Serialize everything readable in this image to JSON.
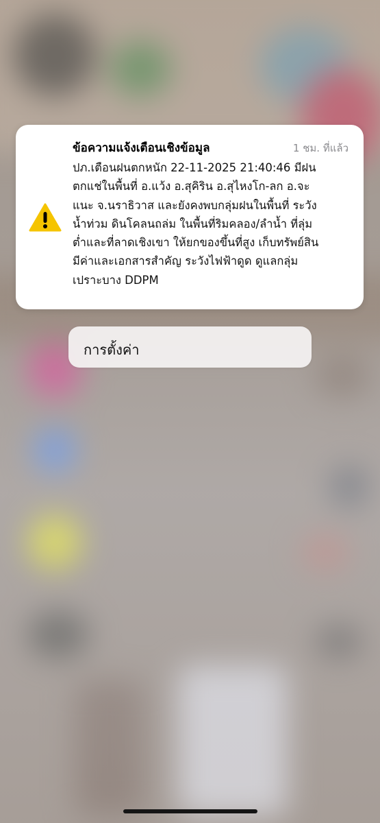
{
  "notification": {
    "title": "ข้อความแจ้งเตือนเชิงข้อมูล",
    "time": "1 ชม. ที่แล้ว",
    "icon": "warning-icon",
    "accent_color": "#f5c400",
    "body_lines": [
      "ปภ.เตือนฝนตกหนัก  22-11-2025 21:40:46 มีฝน",
      "ตกแช่ในพื้นที่ อ.แว้ง อ.สุคิริน อ.สุไหงโก-ลก อ.จะ",
      "แนะ จ.นราธิวาส และยังคงพบกลุ่มฝนในพื้นที่ ระวัง",
      "น้ำท่วม ดินโคลนถล่ม ในพื้นที่ริมคลอง/ลำน้ำ ที่ลุ่ม",
      "ต่ำและที่ลาดเชิงเขา ให้ยกของขึ้นที่สูง เก็บทรัพย์สิน",
      "มีค่าและเอกสารสำคัญ ระวังไฟฟ้าดูด ดูแลกลุ่ม",
      "เปราะบาง DDPM"
    ]
  },
  "settings_button": {
    "label": "การตั้งค่า"
  }
}
